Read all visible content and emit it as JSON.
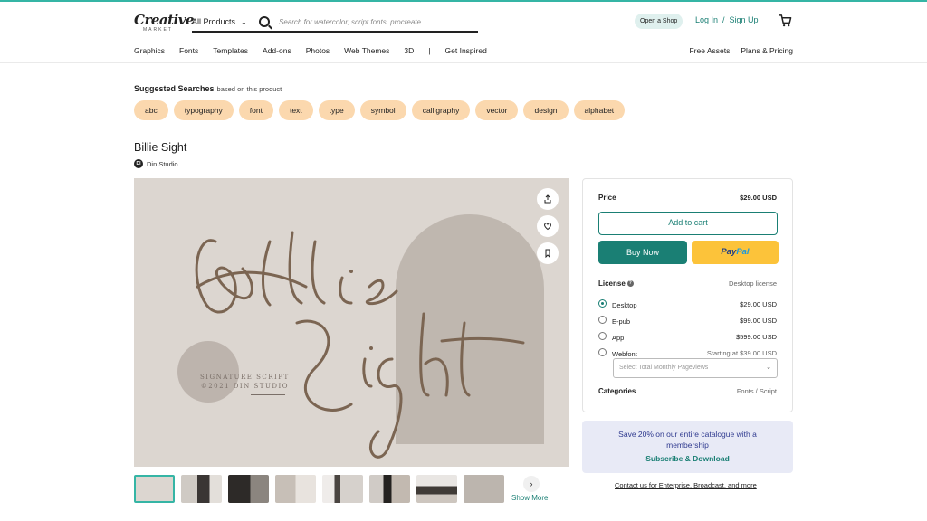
{
  "header": {
    "logo": {
      "word": "Creative",
      "sub": "MARKET"
    },
    "category_select": "All Products",
    "search_placeholder": "Search for watercolor, script fonts, procreate",
    "open_shop": "Open a Shop",
    "login": "Log In",
    "separator": "/",
    "signup": "Sign Up",
    "nav": [
      "Graphics",
      "Fonts",
      "Templates",
      "Add-ons",
      "Photos",
      "Web Themes",
      "3D",
      "|",
      "Get Inspired"
    ],
    "nav_right": [
      "Free Assets",
      "Plans & Pricing"
    ]
  },
  "suggested": {
    "title": "Suggested Searches",
    "subtitle": "based on this product",
    "tags": [
      "abc",
      "typography",
      "font",
      "text",
      "type",
      "symbol",
      "calligraphy",
      "vector",
      "design",
      "alphabet"
    ]
  },
  "product": {
    "title": "Billie Sight",
    "studio": "Din Studio",
    "studio_initials": "DI",
    "hero_tagline_1": "SIGNATURE SCRIPT",
    "hero_tagline_2": "©2021 DIN STUDIO",
    "hero_word_1": "Billie",
    "hero_word_2": "Sight"
  },
  "gallery": {
    "show_more": "Show More",
    "next": "›"
  },
  "purchase": {
    "price_label": "Price",
    "price": "$29.00 USD",
    "add_to_cart": "Add to cart",
    "buy_now": "Buy Now",
    "paypal_1": "Pay",
    "paypal_2": "Pal",
    "license_label": "License",
    "license_selected": "Desktop license",
    "options": [
      {
        "name": "Desktop",
        "price": "$29.00 USD"
      },
      {
        "name": "E-pub",
        "price": "$99.00 USD"
      },
      {
        "name": "App",
        "price": "$599.00 USD"
      },
      {
        "name": "Webfont",
        "price": "Starting at $39.00 USD"
      }
    ],
    "pageviews_placeholder": "Select Total Monthly Pageviews",
    "categories_label": "Categories",
    "categories_value": "Fonts / Script"
  },
  "promo": {
    "text": "Save 20% on our entire catalogue with a membership",
    "link": "Subscribe & Download"
  },
  "contact": "Contact us for Enterprise, Broadcast, and more",
  "colors": {
    "accent": "#1a7f74",
    "tag": "#fbd8ae",
    "hero_bg": "#dcd6d0",
    "script": "#7b6552"
  }
}
